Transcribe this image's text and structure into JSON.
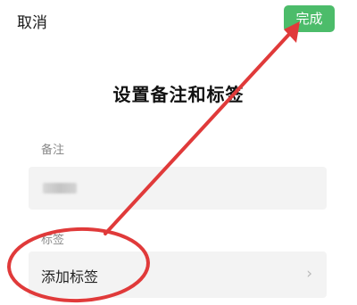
{
  "header": {
    "cancel_label": "取消",
    "done_label": "完成"
  },
  "main": {
    "title": "设置备注和标签",
    "remark_label": "备注",
    "tags_label": "标签",
    "add_tag_label": "添加标签",
    "chevron": "›"
  },
  "colors": {
    "done_button": "#4cbc6a",
    "annotation": "#e03a3a"
  },
  "icons": {
    "tags_chevron": "chevron-right-icon"
  }
}
